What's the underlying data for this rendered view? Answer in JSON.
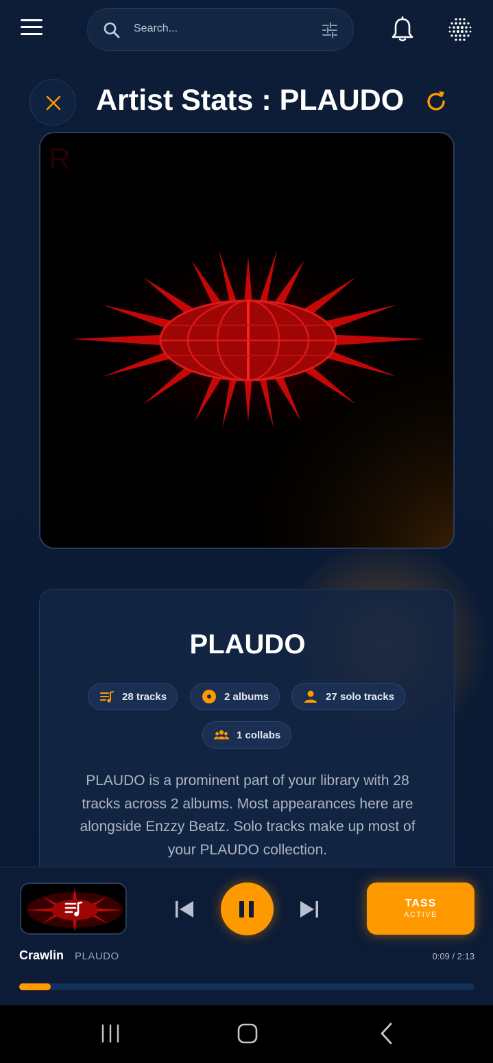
{
  "search": {
    "placeholder": "Search..."
  },
  "header": {
    "title": "Artist Stats : PLAUDO"
  },
  "artist": {
    "name": "PLAUDO",
    "stats": [
      {
        "icon": "queue-music-icon",
        "label": "28 tracks"
      },
      {
        "icon": "album-icon",
        "label": "2 albums"
      },
      {
        "icon": "person-icon",
        "label": "27 solo tracks"
      },
      {
        "icon": "group-icon",
        "label": "1 collabs"
      }
    ],
    "description": "PLAUDO is a prominent part of your library with 28 tracks across 2 albums. Most appearances here are alongside Enzzy Beatz. Solo tracks make up most of your PLAUDO collection."
  },
  "player": {
    "track_title": "Crawlin",
    "track_artist": "PLAUDO",
    "time": "0:09 / 2:13",
    "progress": 0.07,
    "tass_label": "TASS",
    "tass_status": "ACTIVE"
  },
  "colors": {
    "accent": "#ff9900",
    "background": "#0b1a33",
    "card": "#132644",
    "artwork_red": "#d10a0a"
  }
}
